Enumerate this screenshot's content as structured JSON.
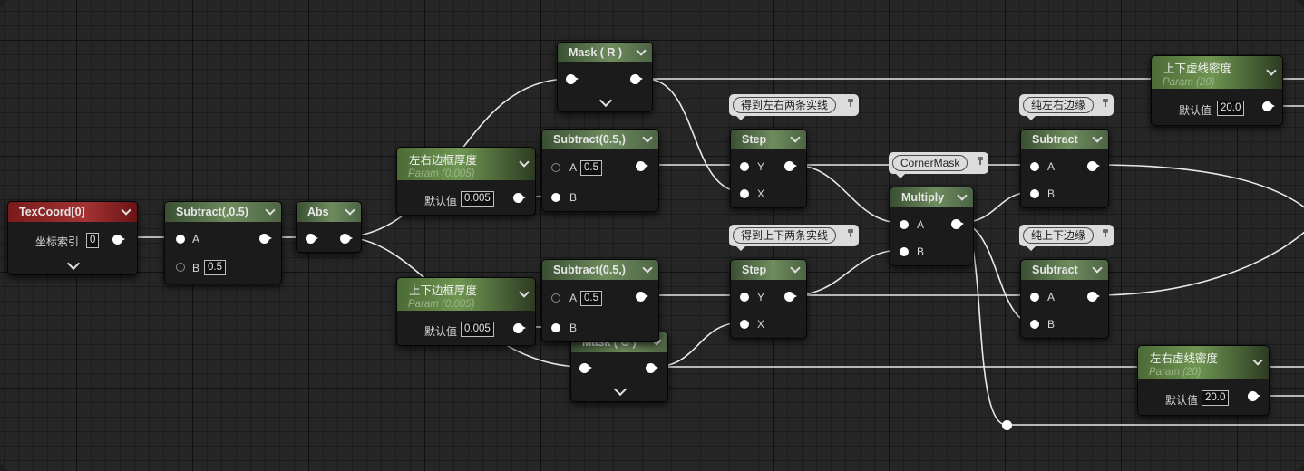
{
  "graph": {
    "tex": {
      "title": "TexCoord[0]",
      "row_label": "坐标索引",
      "row_value": "0"
    },
    "sub05": {
      "title": "Subtract(,0.5)",
      "pin_a": "A",
      "pin_b": "B",
      "b_value": "0.5"
    },
    "abs": {
      "title": "Abs"
    },
    "maskR": {
      "title": "Mask ( R )"
    },
    "maskG": {
      "title": "Mask ( G )"
    },
    "lrBorder": {
      "title": "左右边框厚度",
      "subtitle": "Param (0.005)",
      "label": "默认值",
      "value": "0.005"
    },
    "udBorder": {
      "title": "上下边框厚度",
      "subtitle": "Param (0.005)",
      "label": "默认值",
      "value": "0.005"
    },
    "subHalf1": {
      "title": "Subtract(0.5,)",
      "pin_a": "A",
      "a_value": "0.5",
      "pin_b": "B"
    },
    "subHalf2": {
      "title": "Subtract(0.5,)",
      "pin_a": "A",
      "a_value": "0.5",
      "pin_b": "B"
    },
    "step1": {
      "title": "Step",
      "pin_y": "Y",
      "pin_x": "X",
      "comment": "得到左右两条实线"
    },
    "step2": {
      "title": "Step",
      "pin_y": "Y",
      "pin_x": "X",
      "comment": "得到上下两条实线"
    },
    "multiply": {
      "title": "Multiply",
      "pin_a": "A",
      "pin_b": "B",
      "comment": "CornerMask"
    },
    "subLR": {
      "title": "Subtract",
      "pin_a": "A",
      "pin_b": "B",
      "comment": "纯左右边缘"
    },
    "subUD": {
      "title": "Subtract",
      "pin_a": "A",
      "pin_b": "B",
      "comment": "纯上下边缘"
    },
    "udDensity": {
      "title": "上下虚线密度",
      "subtitle": "Param (20)",
      "label": "默认值",
      "value": "20.0"
    },
    "lrDensity": {
      "title": "左右虚线密度",
      "subtitle": "Param (20)",
      "label": "默认值",
      "value": "20.0"
    }
  },
  "colors": {
    "wire": "#e8e8e8",
    "grid_bg": "#262626",
    "node_green": "#6e8c5e",
    "node_red": "#a43333",
    "param_green": "#6f9651"
  }
}
